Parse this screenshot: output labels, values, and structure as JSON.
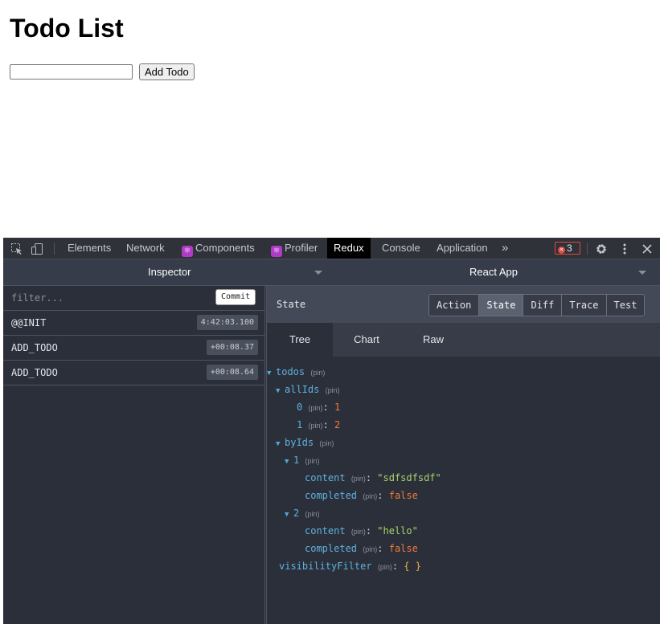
{
  "page": {
    "title": "Todo List",
    "input_value": "",
    "add_button": "Add Todo"
  },
  "devtools": {
    "toolbar": {
      "tabs": [
        "Elements",
        "Network",
        "Components",
        "Profiler",
        "Redux",
        "Console",
        "Application"
      ],
      "active_tab": "Redux",
      "more": "»",
      "error_count": "3",
      "icons": [
        "inspect-icon",
        "device-toggle-icon",
        "gear-icon",
        "kebab-menu-icon",
        "close-icon"
      ]
    },
    "inspector": {
      "monitor": "Inspector",
      "instance": "React App"
    },
    "actions": {
      "filter_placeholder": "filter...",
      "commit_label": "Commit",
      "items": [
        {
          "name": "@@INIT",
          "time": "4:42:03.100"
        },
        {
          "name": "ADD_TODO",
          "time": "+00:08.37"
        },
        {
          "name": "ADD_TODO",
          "time": "+00:08.64"
        }
      ]
    },
    "state_panel": {
      "title": "State",
      "buttons": [
        "Action",
        "State",
        "Diff",
        "Trace",
        "Test"
      ],
      "active_button": "State",
      "view_tabs": [
        "Tree",
        "Chart",
        "Raw"
      ],
      "active_view": "Tree",
      "pin": "(pin)",
      "tree": {
        "todos": "todos",
        "allIds": "allIds",
        "allIds_items": [
          {
            "key": "0",
            "value": "1"
          },
          {
            "key": "1",
            "value": "2"
          }
        ],
        "byIds": "byIds",
        "byIds_items": [
          {
            "key": "1",
            "content_key": "content",
            "content": "\"sdfsdfsdf\"",
            "completed_key": "completed",
            "completed": "false"
          },
          {
            "key": "2",
            "content_key": "content",
            "content": "\"hello\"",
            "completed_key": "completed",
            "completed": "false"
          }
        ],
        "visibilityFilter": "visibilityFilter",
        "visibilityFilter_value": "{ }"
      }
    }
  }
}
